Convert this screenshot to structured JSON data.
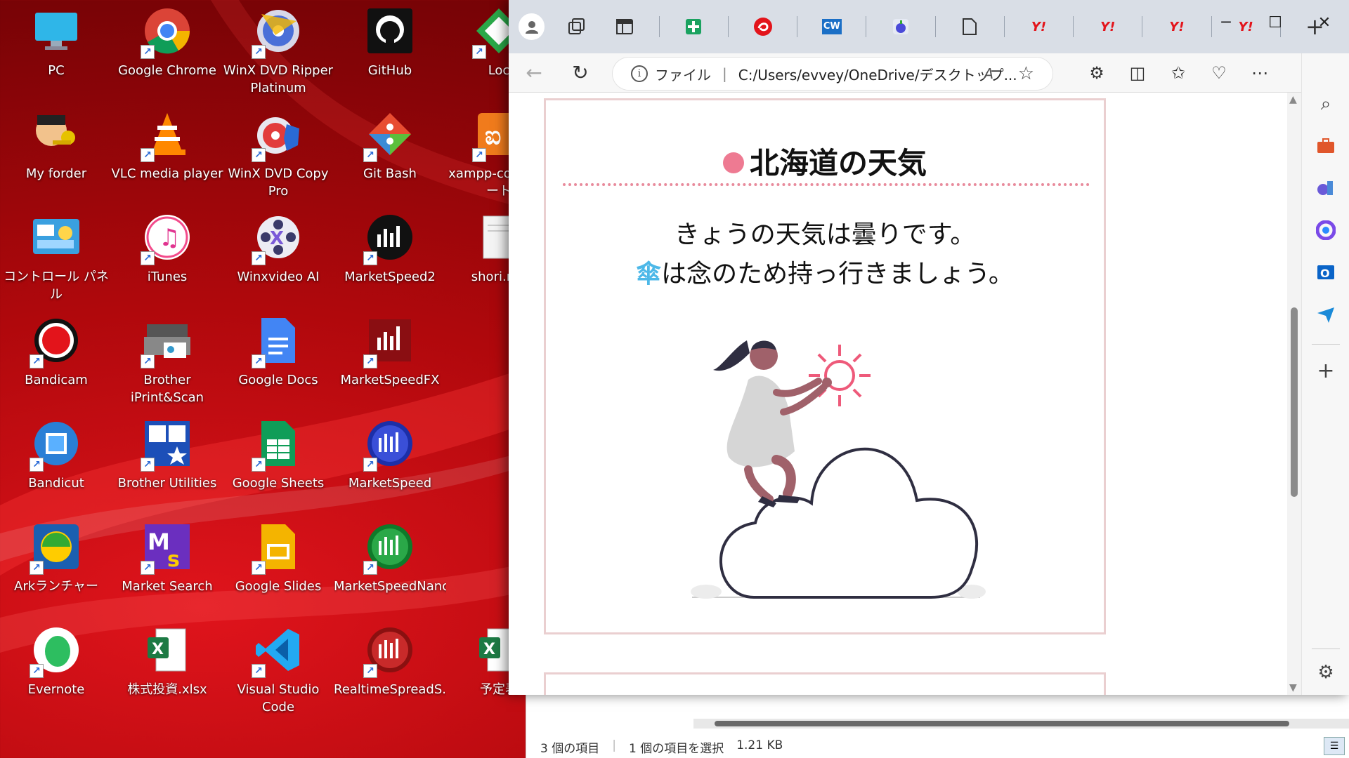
{
  "desktop": {
    "icons": [
      {
        "label": "PC",
        "icon": "pc-icon"
      },
      {
        "label": "Google Chrome",
        "icon": "chrome-icon"
      },
      {
        "label": "WinX DVD Ripper Platinum",
        "icon": "winx-ripper-icon"
      },
      {
        "label": "GitHub",
        "icon": "github-icon"
      },
      {
        "label": "Loc",
        "icon": "loc-icon"
      },
      {
        "label": "My forder",
        "icon": "my-forder-icon"
      },
      {
        "label": "VLC media player",
        "icon": "vlc-icon"
      },
      {
        "label": "WinX DVD Copy Pro",
        "icon": "winx-copy-icon"
      },
      {
        "label": "Git Bash",
        "icon": "git-bash-icon"
      },
      {
        "label": "xampp-co - ショート",
        "icon": "xampp-icon"
      },
      {
        "label": "コントロール パネル",
        "icon": "control-panel-icon"
      },
      {
        "label": "iTunes",
        "icon": "itunes-icon"
      },
      {
        "label": "Winxvideo AI",
        "icon": "winxvideo-icon"
      },
      {
        "label": "MarketSpeed2",
        "icon": "marketspeed2-icon"
      },
      {
        "label": "shori.mo",
        "icon": "text-file-icon"
      },
      {
        "label": "Bandicam",
        "icon": "bandicam-icon"
      },
      {
        "label": "Brother iPrint&Scan",
        "icon": "brother-iprint-icon"
      },
      {
        "label": "Google Docs",
        "icon": "google-docs-icon"
      },
      {
        "label": "MarketSpeedFX",
        "icon": "marketspeedfx-icon"
      },
      {
        "label": "Bandicut",
        "icon": "bandicut-icon"
      },
      {
        "label": "Brother Utilities",
        "icon": "brother-utilities-icon"
      },
      {
        "label": "Google Sheets",
        "icon": "google-sheets-icon"
      },
      {
        "label": "MarketSpeed",
        "icon": "marketspeed-icon"
      },
      {
        "label": "Arkランチャー",
        "icon": "ark-launcher-icon"
      },
      {
        "label": "Market Search",
        "icon": "market-search-icon"
      },
      {
        "label": "Google Slides",
        "icon": "google-slides-icon"
      },
      {
        "label": "MarketSpeedNano",
        "icon": "marketspeednano-icon"
      },
      {
        "label": "Evernote",
        "icon": "evernote-icon"
      },
      {
        "label": "株式投資.xlsx",
        "icon": "excel-file-icon"
      },
      {
        "label": "Visual Studio Code",
        "icon": "vscode-icon"
      },
      {
        "label": "RealtimeSpreadS...",
        "icon": "realtimespread-icon"
      },
      {
        "label": "予定表",
        "icon": "excel-file-icon"
      }
    ]
  },
  "browser": {
    "tabs": [
      "profile",
      "workspaces",
      "tab-actions",
      "google-sheets",
      "recruit",
      "cw",
      "apple",
      "document",
      "yahoo",
      "yahoo",
      "yahoo",
      "yahoo"
    ],
    "yahoo_glyph": "Y!",
    "cw_label": "CW",
    "new_tab": "+",
    "address": {
      "file_label": "ファイル",
      "url": "C:/Users/evvey/OneDrive/デスクトップ..."
    },
    "page": {
      "title": "北海道の天気",
      "line1": "きょうの天気は曇りです。",
      "umbrella": "傘",
      "line2_rest": "は念のため持っ行きましょう。"
    },
    "accent_colors": {
      "dot": "#ee7a92",
      "umbrella": "#4db8e8",
      "border": "#eacfd0"
    }
  },
  "explorer": {
    "item_count": "3 個の項目",
    "selection": "1 個の項目を選択",
    "size": "1.21 KB"
  }
}
